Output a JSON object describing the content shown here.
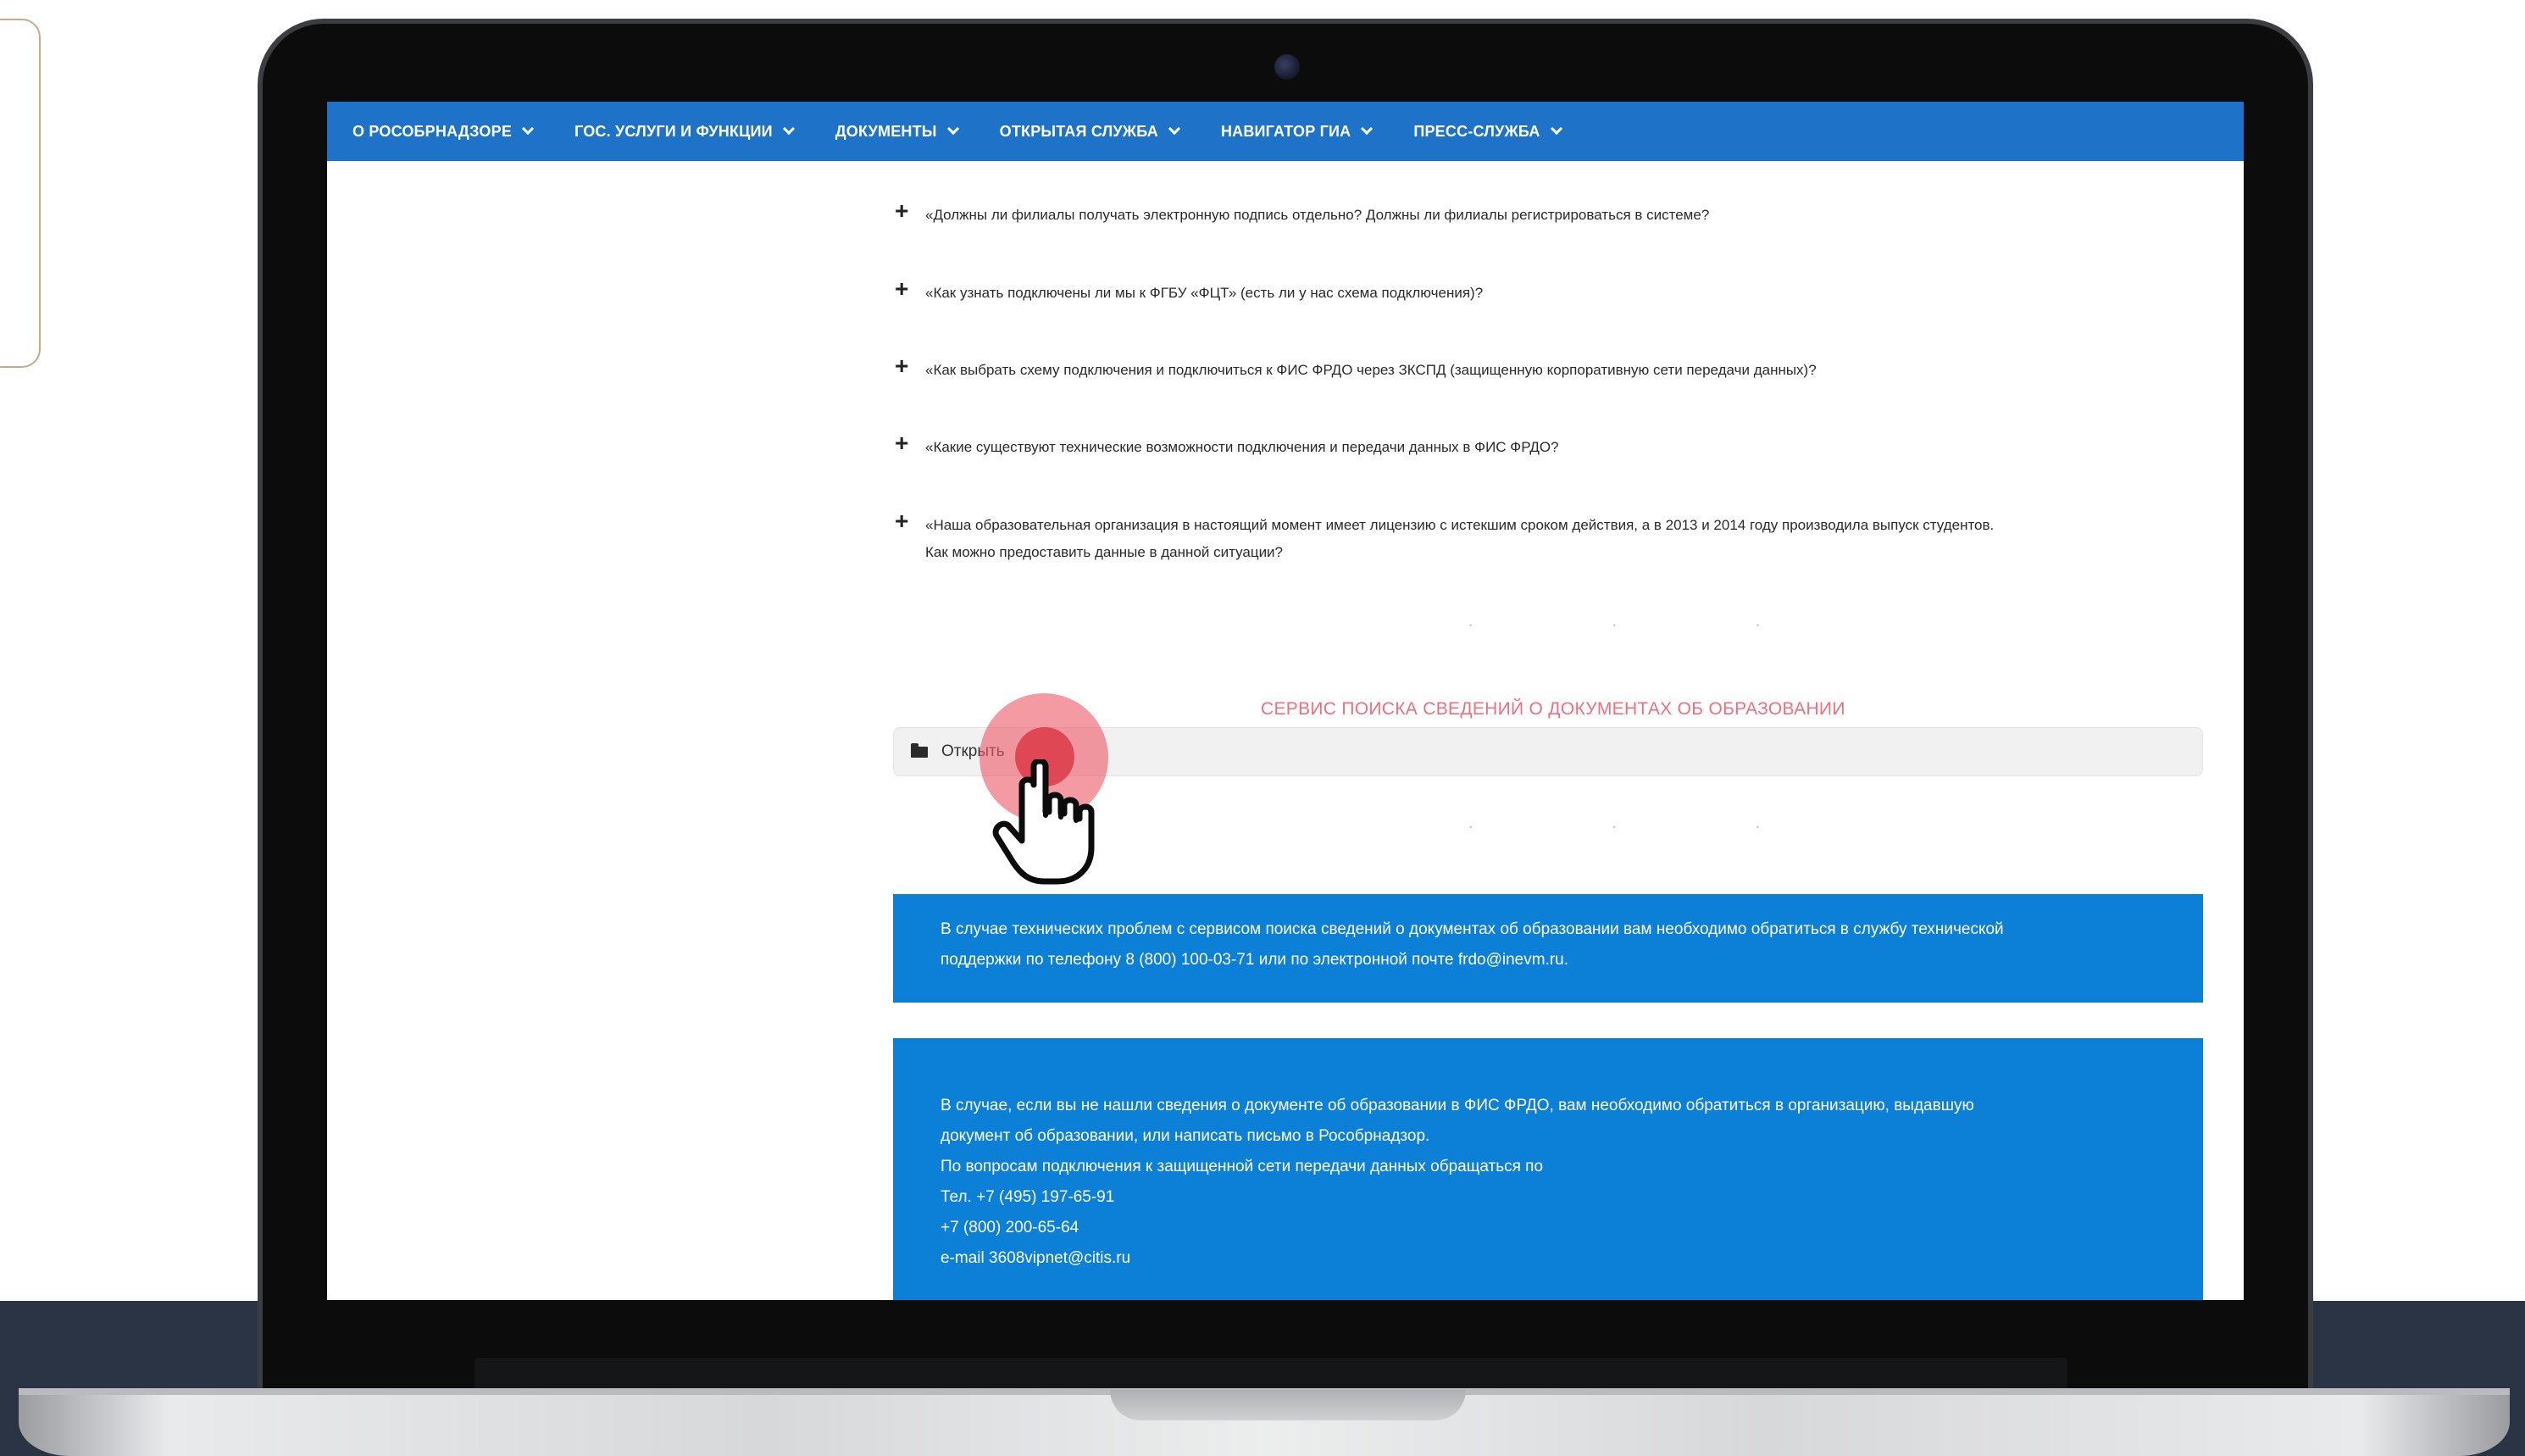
{
  "nav": {
    "items": [
      {
        "label": "О РОСОБРНАДЗОРЕ"
      },
      {
        "label": "ГОС. УСЛУГИ И ФУНКЦИИ"
      },
      {
        "label": "ДОКУМЕНТЫ"
      },
      {
        "label": "ОТКРЫТАЯ СЛУЖБА"
      },
      {
        "label": "НАВИГАТОР ГИА"
      },
      {
        "label": "ПРЕСС-СЛУЖБА"
      }
    ]
  },
  "faq": [
    {
      "question": "«Должны ли филиалы получать электронную подпись отдельно? Должны ли филиалы регистрироваться в системе?"
    },
    {
      "question": "«Как узнать подключены ли мы к ФГБУ «ФЦТ» (есть ли у нас схема подключения)?"
    },
    {
      "question": "«Как выбрать схему подключения и подключиться к ФИС ФРДО через ЗКСПД (защищенную корпоративную сети передачи данных)?"
    },
    {
      "question": "«Какие существуют технические возможности подключения и передачи данных в ФИС ФРДО?"
    },
    {
      "question": "«Наша образовательная организация в настоящий момент имеет лицензию с истекшим сроком действия, а в 2013 и 2014 году производила выпуск студентов.",
      "question_line2": "Как можно предоставить данные в данной ситуации?"
    }
  ],
  "separator": "· · ·",
  "service": {
    "title": "СЕРВИС ПОИСКА СВЕДЕНИЙ О ДОКУМЕНТАХ ОБ ОБРАЗОВАНИИ",
    "open_label": "Открыть"
  },
  "support_box": {
    "line1": "В случае технических проблем с сервисом поиска сведений о документах об образовании вам необходимо обратиться в службу технической",
    "line2": "поддержки по телефону  8 (800) 100-03-71 или по электронной почте frdo@inevm.ru."
  },
  "contact_box": {
    "line1": "В случае, если вы не нашли сведения о документе об образовании в ФИС ФРДО, вам необходимо обратиться в организацию, выдавшую",
    "line2": "документ об образовании, или написать письмо в Рособрнадзор.",
    "line3": "По вопросам подключения к защищенной сети передачи данных обращаться по",
    "line4": "Тел. +7 (495) 197-65-91",
    "line5": "+7 (800) 200-65-64",
    "line6": "e-mail 3608vipnet@citis.ru"
  },
  "colors": {
    "nav_bg": "#1e73c8",
    "info_bg": "#0c7fd6",
    "service_title": "#ee6f7d",
    "click_highlight": "#e0525e"
  },
  "icons": {
    "accessibility": "accessibility-icon",
    "folder": "folder-icon",
    "cursor": "hand-pointer-icon",
    "faq_toggle": "plus-icon",
    "nav_dropdown": "chevron-down-icon"
  }
}
